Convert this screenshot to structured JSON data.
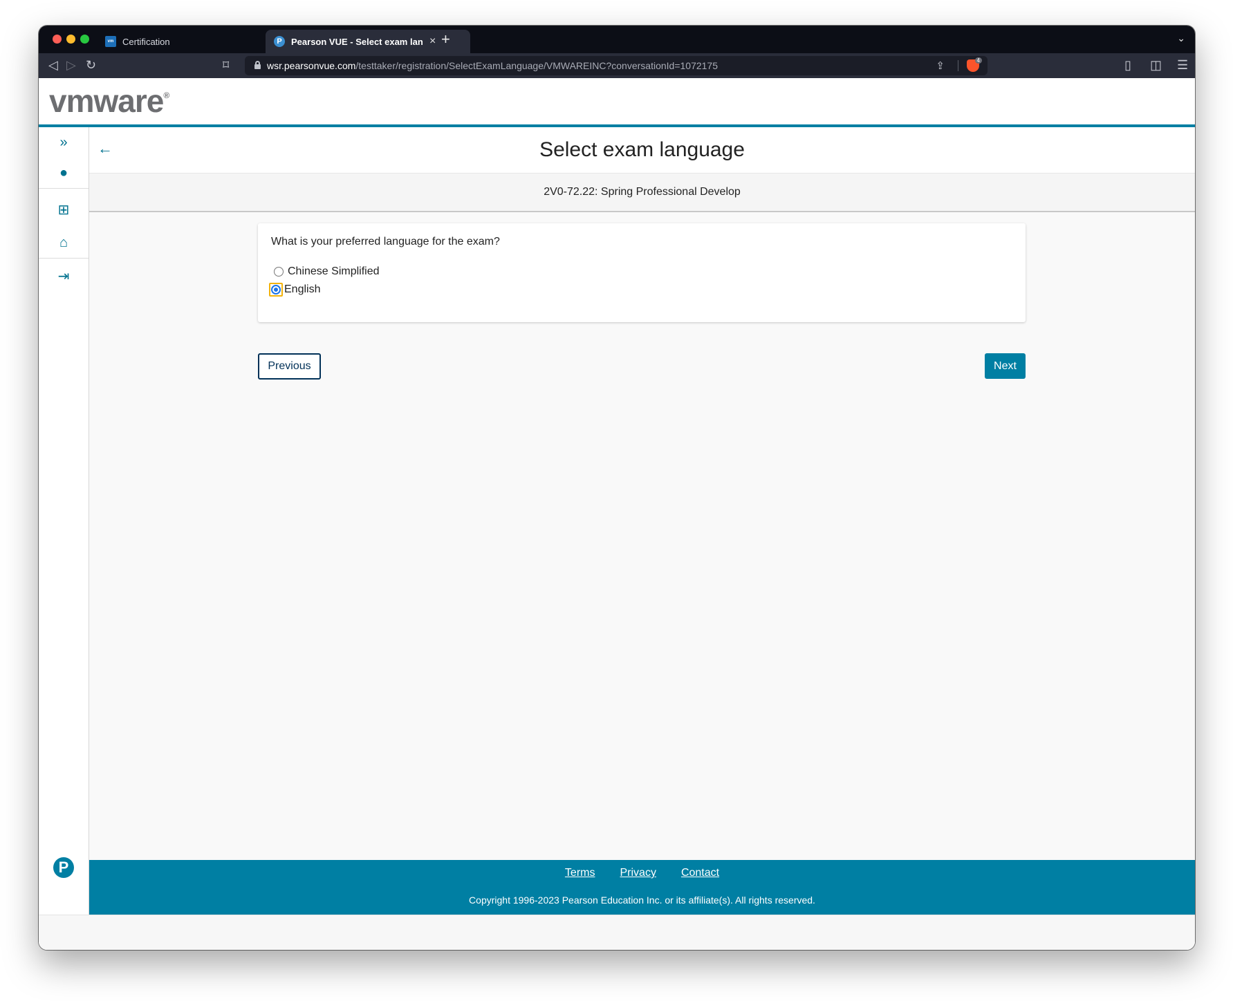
{
  "browser": {
    "tabs": [
      {
        "title": "Certification",
        "favicon": "vmware-favicon",
        "active": false
      },
      {
        "title": "Pearson VUE - Select exam language",
        "favicon": "pearson-favicon",
        "active": true
      }
    ],
    "close_tab_glyph": "×",
    "new_tab_glyph": "+",
    "tab_menu_glyph": "⌄",
    "url_host": "wsr.pearsonvue.com",
    "url_path": "/testtaker/registration/SelectExamLanguage/VMWAREINC?conversationId=1072175",
    "brave_badge": "4",
    "icons": {
      "back": "◁",
      "forward": "▷",
      "reload": "↻",
      "bookmark": "⌑",
      "share": "⇪",
      "sidebar": "▯",
      "wallet": "◫",
      "menu": "☰"
    }
  },
  "header": {
    "logo_text": "vmware",
    "logo_mark": "®"
  },
  "sidebar": {
    "expand_icon": "»",
    "profile_icon": "●",
    "sitemap_icon": "⊞",
    "home_icon": "⌂",
    "signout_icon": "⇥",
    "brand_mark": "P"
  },
  "main": {
    "back_icon": "←",
    "title": "Select exam language",
    "exam_name": "2V0-72.22: Spring Professional Develop",
    "question": "What is your preferred language for the exam?",
    "options": [
      {
        "label": "Chinese Simplified",
        "selected": false
      },
      {
        "label": "English",
        "selected": true
      }
    ],
    "previous_label": "Previous",
    "next_label": "Next"
  },
  "footer": {
    "links": [
      "Terms",
      "Privacy",
      "Contact"
    ],
    "copyright": "Copyright 1996-2023 Pearson Education Inc. or its affiliate(s). All rights reserved."
  },
  "colors": {
    "accent": "#007fa3",
    "primary_dark": "#003057",
    "focus_ring": "#f2b20c"
  }
}
